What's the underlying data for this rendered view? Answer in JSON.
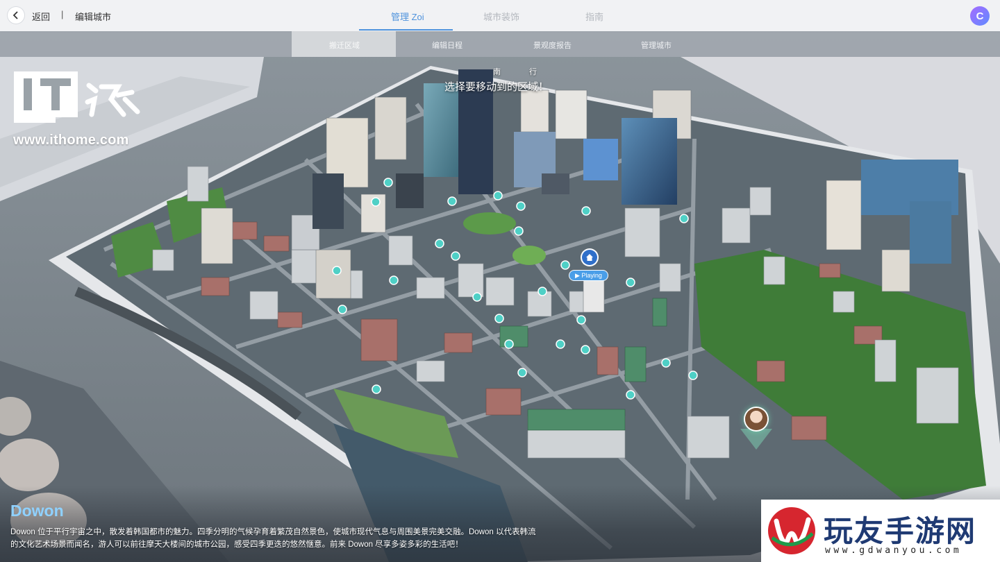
{
  "header": {
    "back_label": "返回",
    "separator": "|",
    "breadcrumb": "编辑城市",
    "tabs": [
      {
        "label": "管理 Zoi",
        "active": true
      },
      {
        "label": "城市装饰",
        "active": false
      },
      {
        "label": "指南",
        "active": false
      }
    ],
    "profile_initial": "C"
  },
  "subtabs": [
    {
      "label": "搬迁区域",
      "active": true
    },
    {
      "label": "编辑日程",
      "active": false
    },
    {
      "label": "景观度报告",
      "active": false
    },
    {
      "label": "管理城市",
      "active": false
    }
  ],
  "map": {
    "compass_north": "南",
    "compass_south": "行",
    "prompt": "选择要移动到的区域！",
    "playing_badge": "▶ Playing",
    "marker_icon": "home-icon",
    "zoi_icon": "avatar-icon"
  },
  "city": {
    "name": "Dowon",
    "description": "Dowon 位于平行宇宙之中，散发着韩国都市的魅力。四季分明的气候孕育着繁茂自然景色，使城市现代气息与周围美景完美交融。Dowon 以代表韩流的文化艺术场景而闻名，游人可以前往摩天大楼间的城市公园，感受四季更迭的悠然惬意。前来 Dowon 尽享多姿多彩的生活吧！"
  },
  "watermark": {
    "url": "www.ithome.com"
  },
  "partner": {
    "name": "玩友手游网",
    "url": "www.gdwanyou.com"
  },
  "colors": {
    "accent": "#4f93dd",
    "city_name": "#8fd1ff",
    "partner_brand": "#1f3a73",
    "partner_red": "#d6262f",
    "partner_green": "#1f9a4a"
  }
}
